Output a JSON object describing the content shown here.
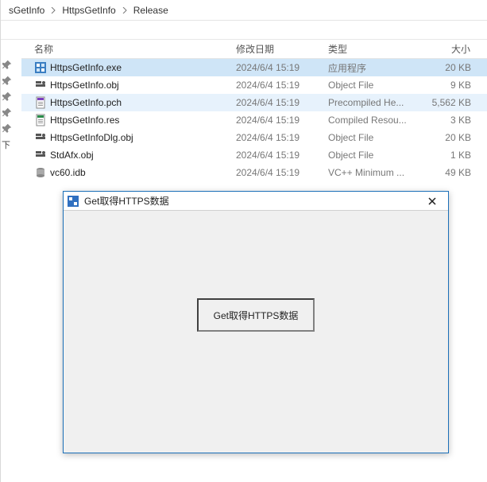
{
  "breadcrumbs": {
    "items": [
      {
        "label": "sGetInfo"
      },
      {
        "label": "HttpsGetInfo"
      },
      {
        "label": "Release"
      }
    ]
  },
  "columns": {
    "name": "名称",
    "modified": "修改日期",
    "type": "类型",
    "size": "大小"
  },
  "files": [
    {
      "icon": "exe",
      "name": "HttpsGetInfo.exe",
      "date": "2024/6/4 15:19",
      "type": "应用程序",
      "size": "20 KB",
      "state": "selected"
    },
    {
      "icon": "obj",
      "name": "HttpsGetInfo.obj",
      "date": "2024/6/4 15:19",
      "type": "Object File",
      "size": "9 KB",
      "state": ""
    },
    {
      "icon": "header",
      "name": "HttpsGetInfo.pch",
      "date": "2024/6/4 15:19",
      "type": "Precompiled He...",
      "size": "5,562 KB",
      "state": "hover"
    },
    {
      "icon": "res",
      "name": "HttpsGetInfo.res",
      "date": "2024/6/4 15:19",
      "type": "Compiled Resou...",
      "size": "3 KB",
      "state": ""
    },
    {
      "icon": "obj",
      "name": "HttpsGetInfoDlg.obj",
      "date": "2024/6/4 15:19",
      "type": "Object File",
      "size": "20 KB",
      "state": ""
    },
    {
      "icon": "obj",
      "name": "StdAfx.obj",
      "date": "2024/6/4 15:19",
      "type": "Object File",
      "size": "1 KB",
      "state": ""
    },
    {
      "icon": "idb",
      "name": "vc60.idb",
      "date": "2024/6/4 15:19",
      "type": "VC++ Minimum ...",
      "size": "49 KB",
      "state": ""
    }
  ],
  "dialog": {
    "title": "Get取得HTTPS数据",
    "button_label": "Get取得HTTPS数据"
  },
  "misc": {
    "below_pins_text": "下"
  }
}
